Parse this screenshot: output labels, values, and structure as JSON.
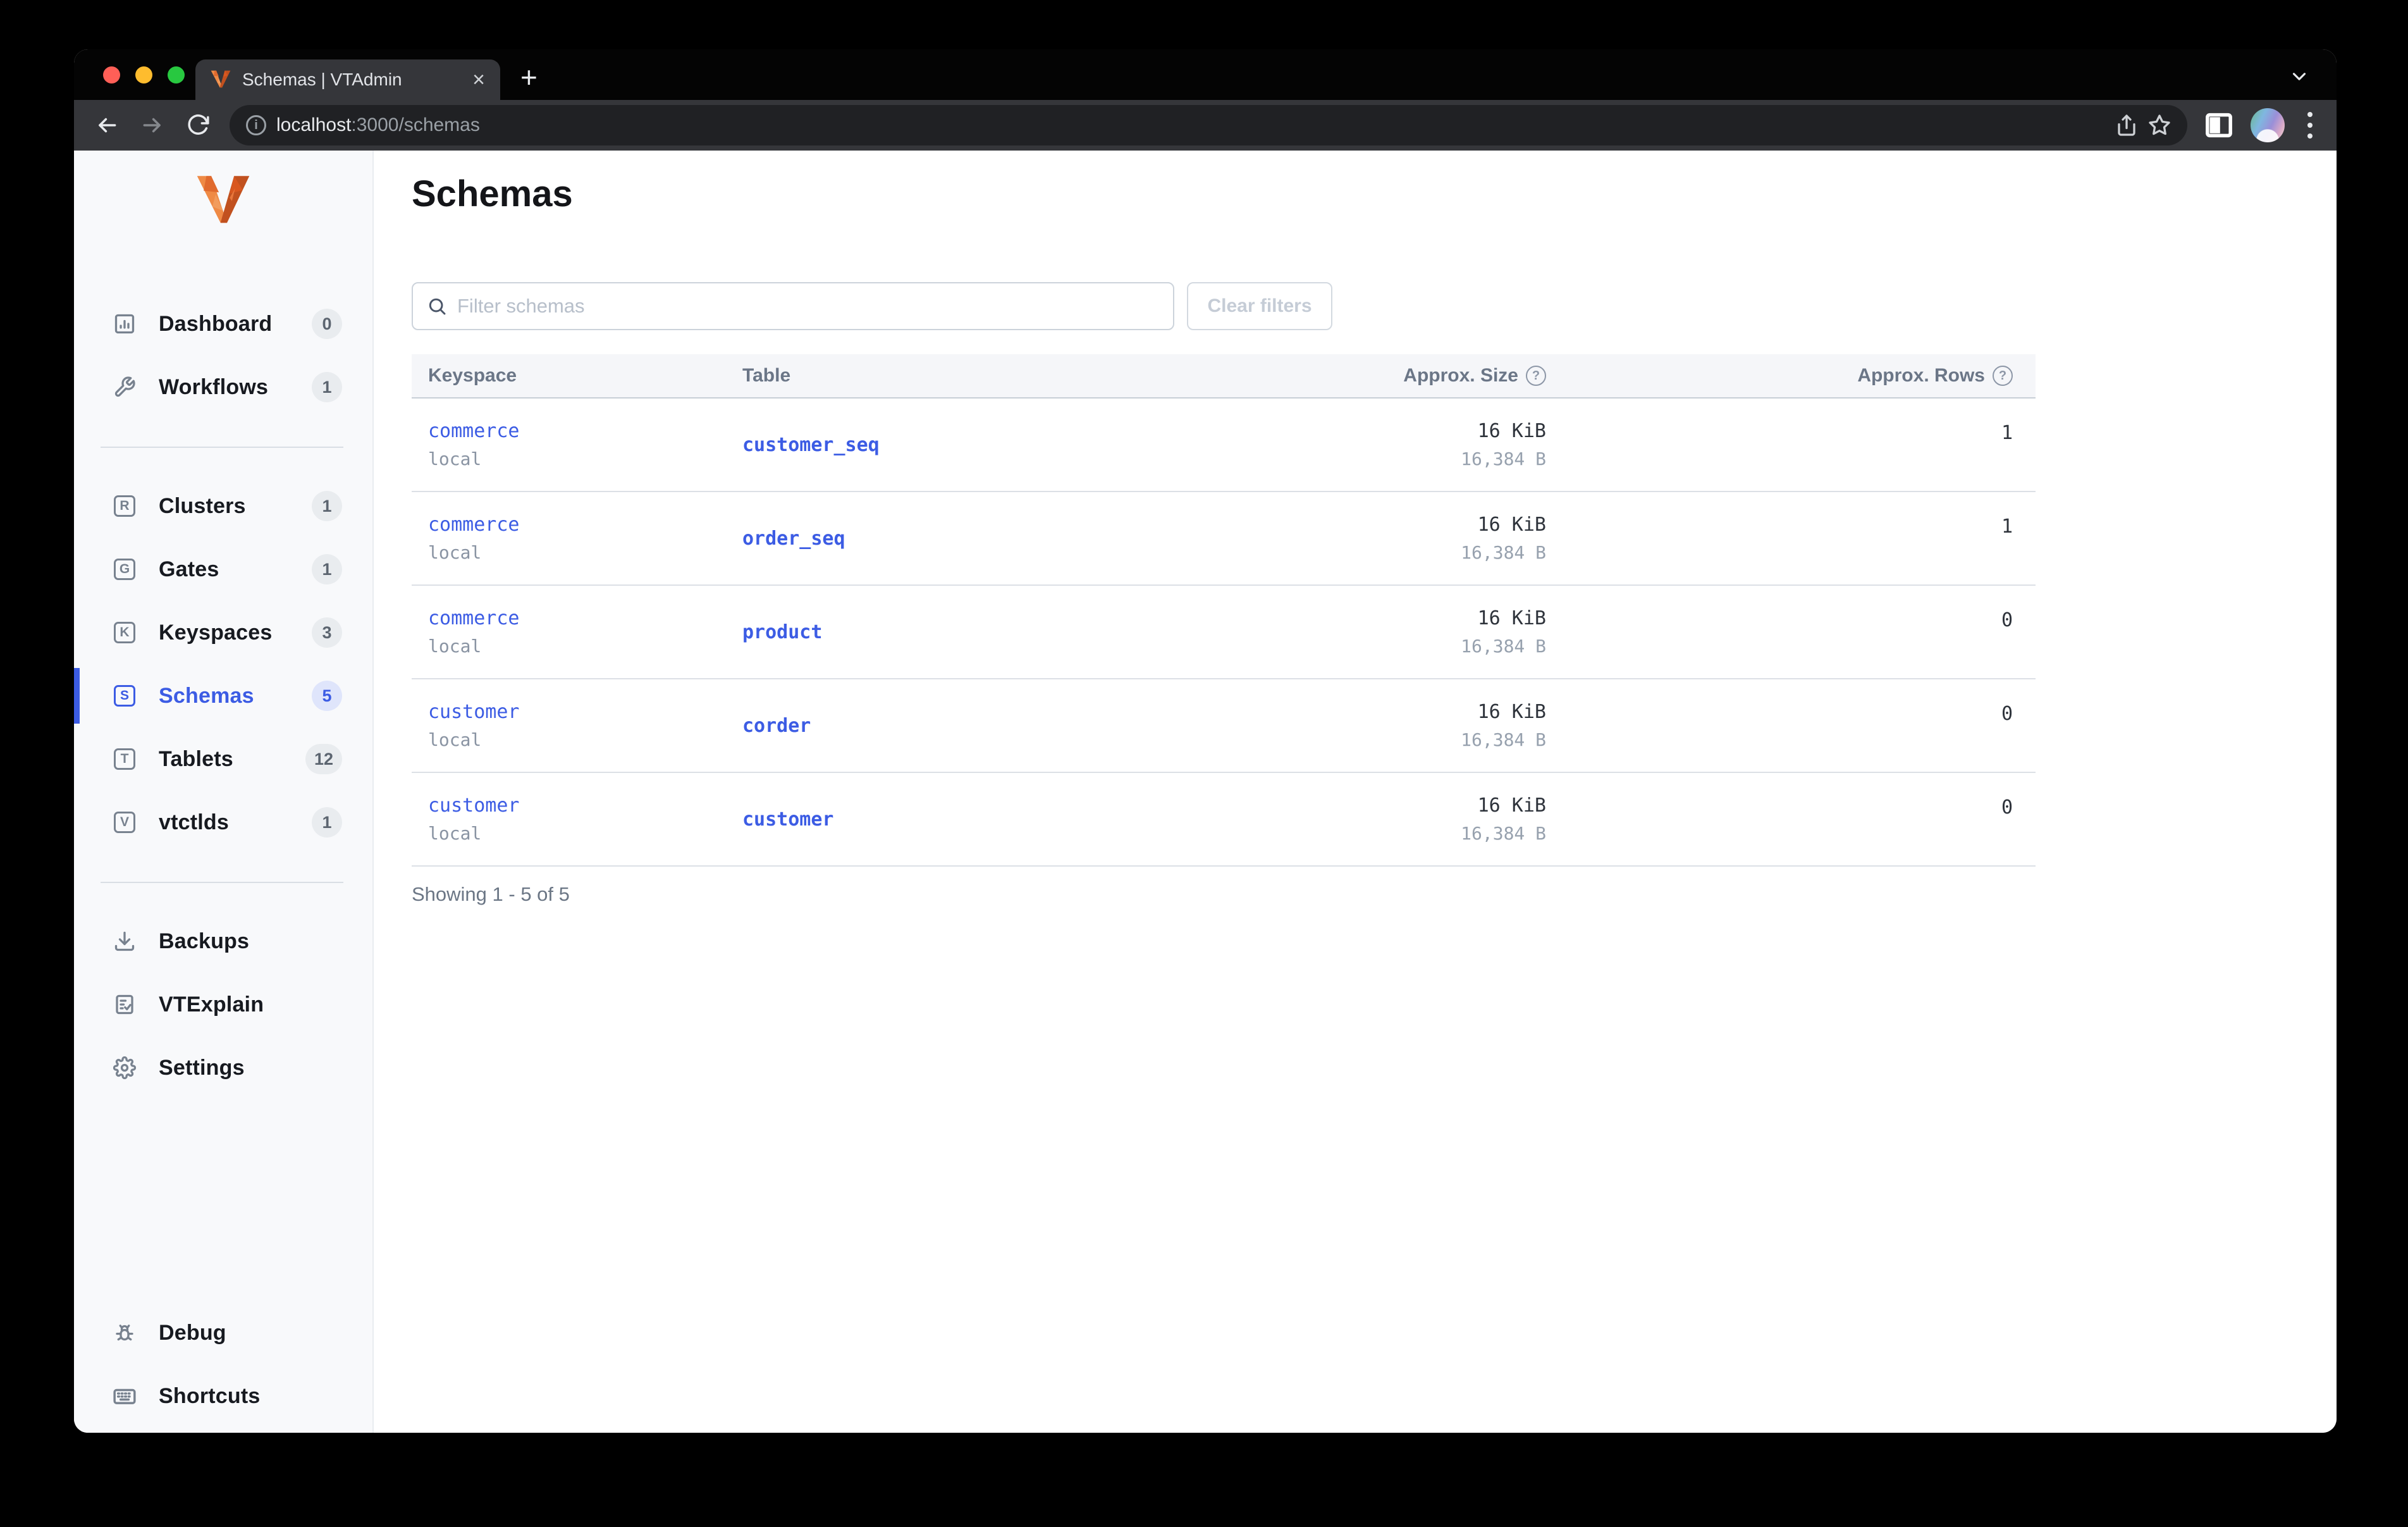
{
  "browser": {
    "tab_title": "Schemas | VTAdmin",
    "close_glyph": "×",
    "new_tab_glyph": "+",
    "url_host": "localhost",
    "url_path": ":3000/schemas"
  },
  "icons": {
    "help": "?",
    "info": "i"
  },
  "sidebar": {
    "items": [
      {
        "label": "Dashboard",
        "count": "0"
      },
      {
        "label": "Workflows",
        "count": "1"
      },
      {
        "label": "Clusters",
        "count": "1",
        "letter": "R"
      },
      {
        "label": "Gates",
        "count": "1",
        "letter": "G"
      },
      {
        "label": "Keyspaces",
        "count": "3",
        "letter": "K"
      },
      {
        "label": "Schemas",
        "count": "5",
        "letter": "S",
        "active": true
      },
      {
        "label": "Tablets",
        "count": "12",
        "letter": "T"
      },
      {
        "label": "vtctlds",
        "count": "1",
        "letter": "V"
      },
      {
        "label": "Backups"
      },
      {
        "label": "VTExplain"
      },
      {
        "label": "Settings"
      },
      {
        "label": "Debug"
      },
      {
        "label": "Shortcuts"
      }
    ]
  },
  "main": {
    "title": "Schemas",
    "filter_placeholder": "Filter schemas",
    "clear_button": "Clear filters",
    "table": {
      "columns": [
        "Keyspace",
        "Table",
        "Approx. Size",
        "Approx. Rows"
      ],
      "rows": [
        {
          "keyspace": "commerce",
          "cluster": "local",
          "table": "customer_seq",
          "size": "16 KiB",
          "size_bytes": "16,384 B",
          "rows": "1"
        },
        {
          "keyspace": "commerce",
          "cluster": "local",
          "table": "order_seq",
          "size": "16 KiB",
          "size_bytes": "16,384 B",
          "rows": "1"
        },
        {
          "keyspace": "commerce",
          "cluster": "local",
          "table": "product",
          "size": "16 KiB",
          "size_bytes": "16,384 B",
          "rows": "0"
        },
        {
          "keyspace": "customer",
          "cluster": "local",
          "table": "corder",
          "size": "16 KiB",
          "size_bytes": "16,384 B",
          "rows": "0"
        },
        {
          "keyspace": "customer",
          "cluster": "local",
          "table": "customer",
          "size": "16 KiB",
          "size_bytes": "16,384 B",
          "rows": "0"
        }
      ]
    },
    "showing": "Showing 1 - 5 of 5"
  },
  "colors": {
    "accent_blue": "#3c5ce4",
    "vitess_orange": "#e8773c",
    "sidebar_bg": "#f8f9fb",
    "toolbar_bg": "#35363a",
    "traffic_red": "#ff5f57",
    "traffic_yellow": "#febc2e",
    "traffic_green": "#28c840"
  }
}
